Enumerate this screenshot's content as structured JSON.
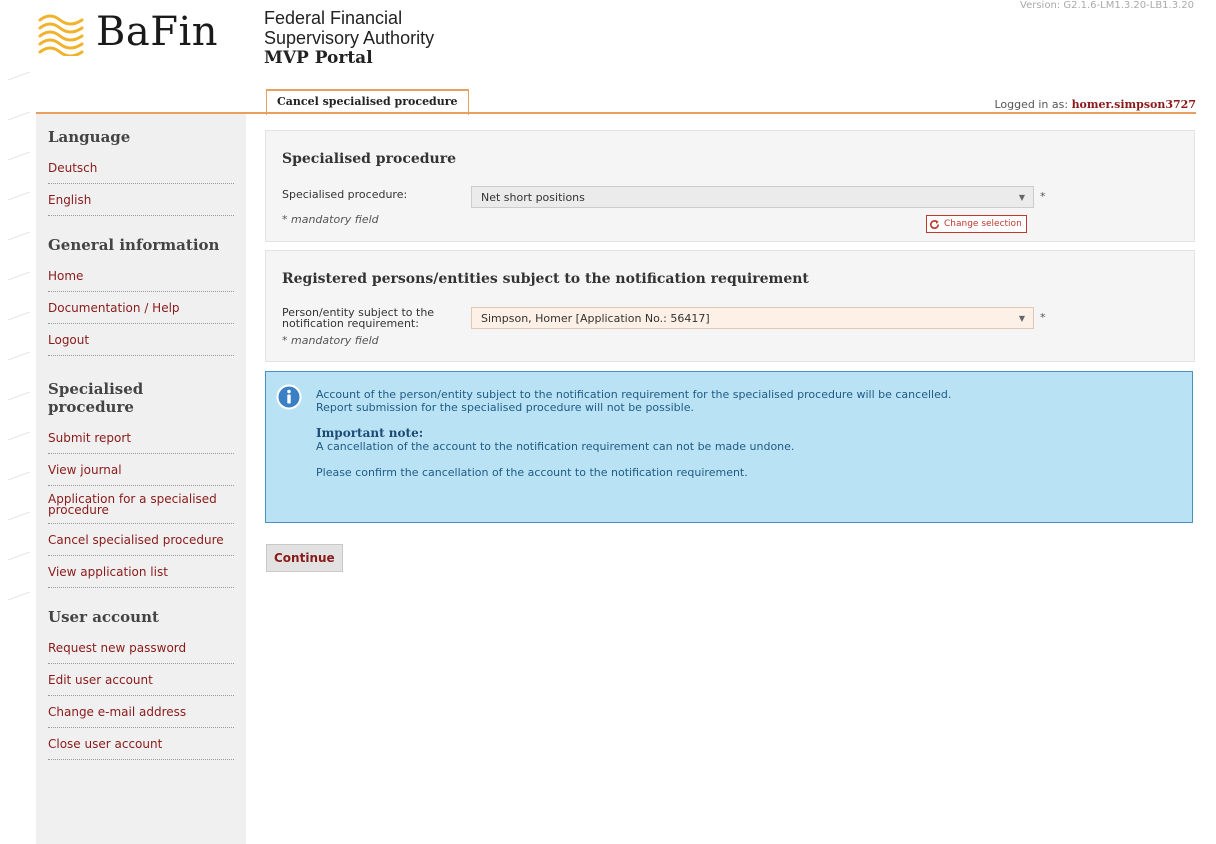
{
  "header": {
    "logo_text": "BaFin",
    "authority_line1": "Federal Financial",
    "authority_line2": "Supervisory Authority",
    "portal_name": "MVP Portal",
    "version": "Version: G2.1.6-LM1.3.20-LB1.3.20",
    "active_tab": "Cancel specialised procedure",
    "logged_in_label": "Logged in as:",
    "logged_in_user": "homer.simpson3727"
  },
  "sidebar": {
    "sections": [
      {
        "title": "Language",
        "items": [
          "Deutsch",
          "English"
        ]
      },
      {
        "title": "General information",
        "items": [
          "Home",
          "Documentation / Help",
          "Logout"
        ]
      },
      {
        "title": "Specialised procedure",
        "items": [
          "Submit report",
          "View journal",
          "Application for a specialised procedure",
          "Cancel specialised procedure",
          "View application list"
        ]
      },
      {
        "title": "User account",
        "items": [
          "Request new password",
          "Edit user account",
          "Change e-mail address",
          "Close user account"
        ]
      }
    ]
  },
  "panel1": {
    "title": "Specialised procedure",
    "label": "Specialised procedure:",
    "value": "Net short positions",
    "mandatory": "* mandatory field",
    "change_button": "Change selection"
  },
  "panel2": {
    "title": "Registered persons/entities subject to the notification requirement",
    "label_line1": "Person/entity subject to the",
    "label_line2": "notification requirement:",
    "value": "Simpson, Homer [Application No.: 56417]",
    "mandatory": "* mandatory field"
  },
  "info": {
    "line1": "Account of the person/entity subject to the notification requirement for the specialised procedure will be cancelled.",
    "line2": "Report submission for the specialised procedure will not be possible.",
    "important_heading": "Important note:",
    "important_text": "A cancellation of the account to the notification requirement can not be made undone.",
    "confirm_text": "Please confirm the cancellation of the account to the notification requirement."
  },
  "continue_label": "Continue",
  "colors": {
    "accent_orange": "#e8a060",
    "link_red": "#8b1a1a",
    "info_bg": "#b9e3f5",
    "info_border": "#4a90c2"
  },
  "icons": {
    "logo": "bafin-waves-icon",
    "change": "refresh-icon",
    "info": "info-icon",
    "select_arrow": "chevron-down-icon"
  }
}
